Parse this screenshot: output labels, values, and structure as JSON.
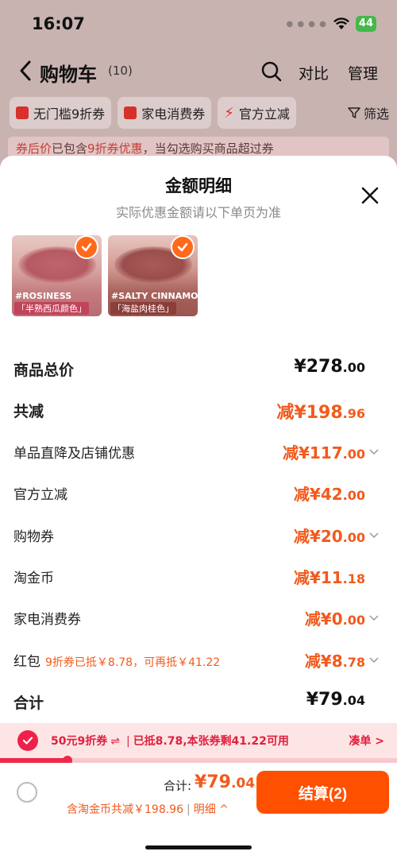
{
  "status_bar": {
    "time": "16:07",
    "battery": "44"
  },
  "nav": {
    "title": "购物车",
    "count": "(10)",
    "compare": "对比",
    "manage": "管理"
  },
  "chips": [
    {
      "label": "无门槛9折券"
    },
    {
      "label": "家电消费券"
    },
    {
      "label": "官方立减"
    }
  ],
  "filter_label": "筛选",
  "notice": {
    "highlight": "券后价",
    "text1": "已包含",
    "highlight2": "9折券优惠",
    "text2": "，当勾选购买商品超过券"
  },
  "sheet": {
    "title": "金额明细",
    "subtitle": "实际优惠金额请以下单页为准"
  },
  "products": [
    {
      "name": "#ROSINESS",
      "sub": "「半熟西瓜颜色」"
    },
    {
      "name": "#SALTY CINNAMON",
      "sub": "「海盐肉桂色」"
    }
  ],
  "rows": {
    "subtotal": {
      "label": "商品总价",
      "value_int": "¥278",
      "value_dec": ".00"
    },
    "total_discount": {
      "label": "共减",
      "value_int": "减¥198",
      "value_dec": ".96"
    },
    "store_discount": {
      "label": "单品直降及店铺优惠",
      "value_int": "减¥117",
      "value_dec": ".00"
    },
    "official": {
      "label": "官方立减",
      "value_int": "减¥42",
      "value_dec": ".00"
    },
    "shopping_coupon": {
      "label": "购物券",
      "value_int": "减¥20",
      "value_dec": ".00"
    },
    "taojinbi": {
      "label": "淘金币",
      "value_int": "减¥11",
      "value_dec": ".18"
    },
    "appliance": {
      "label": "家电消费券",
      "value_int": "减¥0",
      "value_dec": ".00"
    },
    "red_packet": {
      "label": "红包",
      "note": "9折券已抵￥8.78，可再抵￥41.22",
      "value_int": "减¥8",
      "value_dec": ".78"
    },
    "total": {
      "label": "合计",
      "value_int": "¥79",
      "value_dec": ".04"
    }
  },
  "coupon_bar": {
    "name": "50元9折券",
    "swap": "⇌",
    "status": "已抵8.78,本张券剩41.22可用",
    "link": "凑单 >",
    "progress": 0.17
  },
  "footer": {
    "total_label": "合计:",
    "total_int": "¥79",
    "total_dec": ".04",
    "discount_text": "含淘金币共减￥198.96",
    "detail_link": "明细 ^",
    "checkout": "结算(2)"
  },
  "colors": {
    "accent": "#ff5000",
    "price": "#f25a1c",
    "coupon": "#e0203f"
  }
}
